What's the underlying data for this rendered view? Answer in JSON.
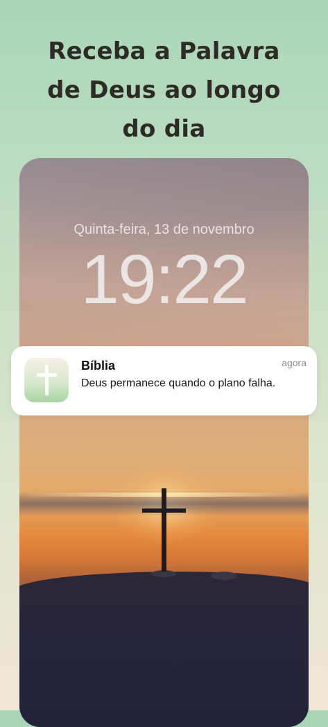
{
  "headline": {
    "line1": "Receba a Palavra",
    "line2": "de Deus ao longo",
    "line3": "do dia"
  },
  "lockscreen": {
    "date": "Quinta-feira, 13 de novembro",
    "time": "19:22"
  },
  "notification": {
    "app_name": "Bíblia",
    "time": "agora",
    "message": "Deus permanece quando o plano falha.",
    "icon": "cross-icon"
  },
  "colors": {
    "background_top": "#a9d6b8",
    "background_bottom": "#f2e6d6",
    "headline_text": "#2e2a26"
  }
}
